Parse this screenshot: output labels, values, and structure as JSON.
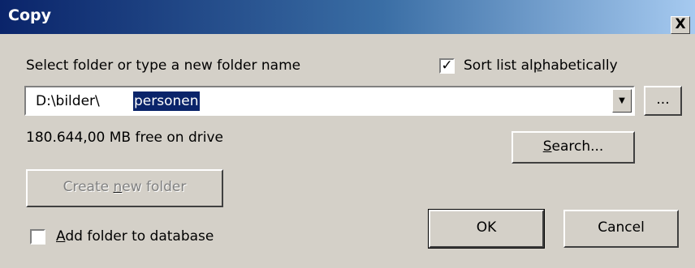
{
  "window": {
    "title": "Copy",
    "close_label": "X"
  },
  "folder_prompt": "Select folder or type a new folder name",
  "sort_checkbox": {
    "label_pre": "Sort list al",
    "label_acc": "p",
    "label_post": "habetically",
    "checked": true
  },
  "path_combo": {
    "value_prefix": "D:\\bilder\\",
    "value_selected": "personen"
  },
  "browse_button": {
    "label": "..."
  },
  "free_space": "180.644,00 MB free on drive",
  "search_button": {
    "label_acc": "S",
    "label_post": "earch..."
  },
  "create_folder_button": {
    "label_pre": "Create ",
    "label_acc": "n",
    "label_post": "ew folder",
    "enabled": false
  },
  "add_db_checkbox": {
    "label_acc": "A",
    "label_post": "dd folder to database",
    "checked": false
  },
  "ok_button": {
    "label": "OK"
  },
  "cancel_button": {
    "label": "Cancel"
  }
}
